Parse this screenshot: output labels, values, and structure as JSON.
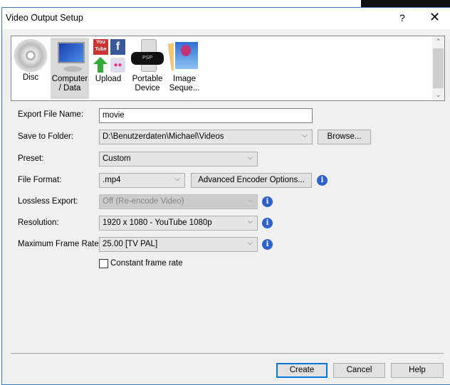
{
  "window": {
    "title": "Video Output Setup",
    "help": "?",
    "close": "✕"
  },
  "gallery": {
    "items": [
      {
        "label": "Disc",
        "icon": "disc-icon"
      },
      {
        "label": "Computer / Data",
        "icon": "computer-icon",
        "selected": true
      },
      {
        "label": "Upload",
        "icon": "upload-icon"
      },
      {
        "label": "Portable Device",
        "icon": "portable-device-icon"
      },
      {
        "label": "Image Seque...",
        "icon": "image-sequence-icon"
      }
    ],
    "youtube_text": "You Tube",
    "psp_text": "PSP"
  },
  "form": {
    "export_name": {
      "label": "Export File Name:",
      "value": "movie"
    },
    "folder": {
      "label": "Save to Folder:",
      "value": "D:\\Benutzerdaten\\Michael\\Videos",
      "browse": "Browse..."
    },
    "preset": {
      "label": "Preset:",
      "value": "Custom"
    },
    "format": {
      "label": "File Format:",
      "value": ".mp4",
      "advanced": "Advanced Encoder Options..."
    },
    "lossless": {
      "label": "Lossless Export:",
      "value": "Off (Re-encode Video)"
    },
    "resolution": {
      "label": "Resolution:",
      "value": "1920 x 1080 - YouTube 1080p"
    },
    "framerate": {
      "label": "Maximum Frame Rate:",
      "value": "25.00 [TV PAL]"
    },
    "constant": {
      "label": "Constant frame rate",
      "checked": false
    }
  },
  "buttons": {
    "create": "Create",
    "cancel": "Cancel",
    "help": "Help"
  },
  "colors": {
    "accent": "#3a7bbd",
    "info": "#2f62c9"
  }
}
